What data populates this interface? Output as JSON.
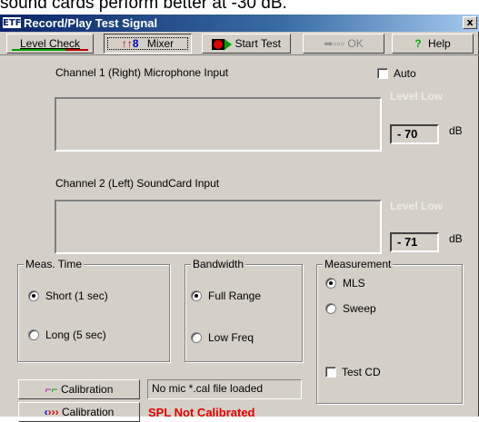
{
  "background_text": "sound cards perform better at -30 dB.",
  "window": {
    "title": "Record/Play Test Signal",
    "app_icon_text": "ETF",
    "close_label": "x"
  },
  "toolbar": {
    "level_check_label": "Level Check",
    "mixer_label": "Mixer",
    "start_test_label": "Start Test",
    "ok_label": "OK",
    "help_label": "Help"
  },
  "channel1": {
    "label": "Channel 1 (Right) Microphone Input",
    "level_status": "Level Low",
    "db_value": "- 70",
    "db_unit": "dB"
  },
  "channel2": {
    "label": "Channel 2 (Left) SoundCard Input",
    "level_status": "Level Low",
    "db_value": "- 71",
    "db_unit": "dB"
  },
  "auto": {
    "label": "Auto",
    "checked": false
  },
  "meas_time": {
    "title": "Meas. Time",
    "options": [
      {
        "label": "Short (1 sec)",
        "selected": true
      },
      {
        "label": "Long (5 sec)",
        "selected": false
      }
    ]
  },
  "bandwidth": {
    "title": "Bandwidth",
    "options": [
      {
        "label": "Full Range",
        "selected": true
      },
      {
        "label": "Low Freq",
        "selected": false
      }
    ]
  },
  "measurement": {
    "title": "Measurement",
    "options": [
      {
        "label": "MLS",
        "selected": true
      },
      {
        "label": "Sweep",
        "selected": false
      }
    ],
    "test_cd_label": "Test CD",
    "test_cd_checked": false
  },
  "calibration": {
    "mic_button_label": "Calibration",
    "speaker_button_label": "Calibration",
    "status_text": "No mic *.cal file loaded",
    "spl_warning": "SPL Not Calibrated"
  },
  "colors": {
    "face": "#d4d0c8",
    "title_bar": "#0a246a",
    "level_low_text": "#ecebe6",
    "warning": "#e00000"
  }
}
